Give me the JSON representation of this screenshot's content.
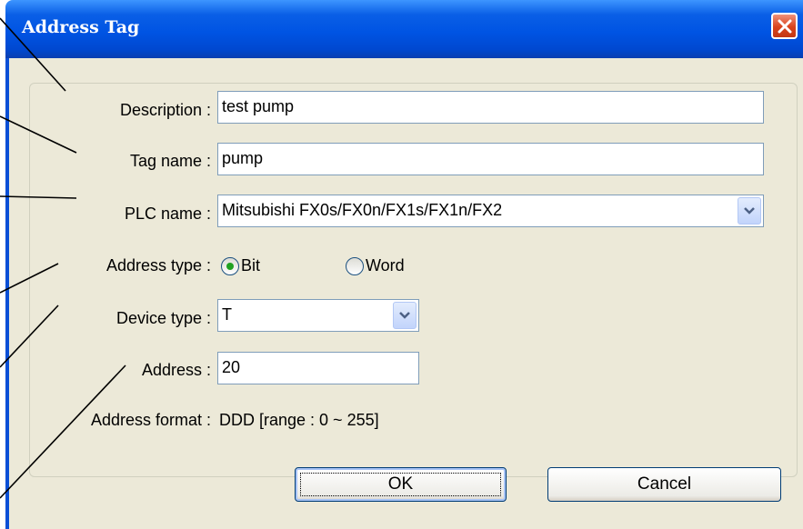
{
  "window": {
    "title": "Address Tag",
    "close_icon": "close-icon",
    "accent_color": "#0054e3",
    "background_color": "#ece9d8"
  },
  "form": {
    "description": {
      "label": "Description :",
      "value": "test pump"
    },
    "tag_name": {
      "label": "Tag name :",
      "value": "pump"
    },
    "plc_name": {
      "label": "PLC name :",
      "selected": "Mitsubishi FX0s/FX0n/FX1s/FX1n/FX2"
    },
    "address_type": {
      "label": "Address type :",
      "options": [
        {
          "label": "Bit",
          "checked": true
        },
        {
          "label": "Word",
          "checked": false
        }
      ]
    },
    "device_type": {
      "label": "Device type :",
      "selected": "T"
    },
    "address": {
      "label": "Address :",
      "value": "20"
    },
    "address_format": {
      "label": "Address format :",
      "value": "DDD [range : 0 ~ 255]"
    }
  },
  "buttons": {
    "ok": "OK",
    "cancel": "Cancel"
  }
}
